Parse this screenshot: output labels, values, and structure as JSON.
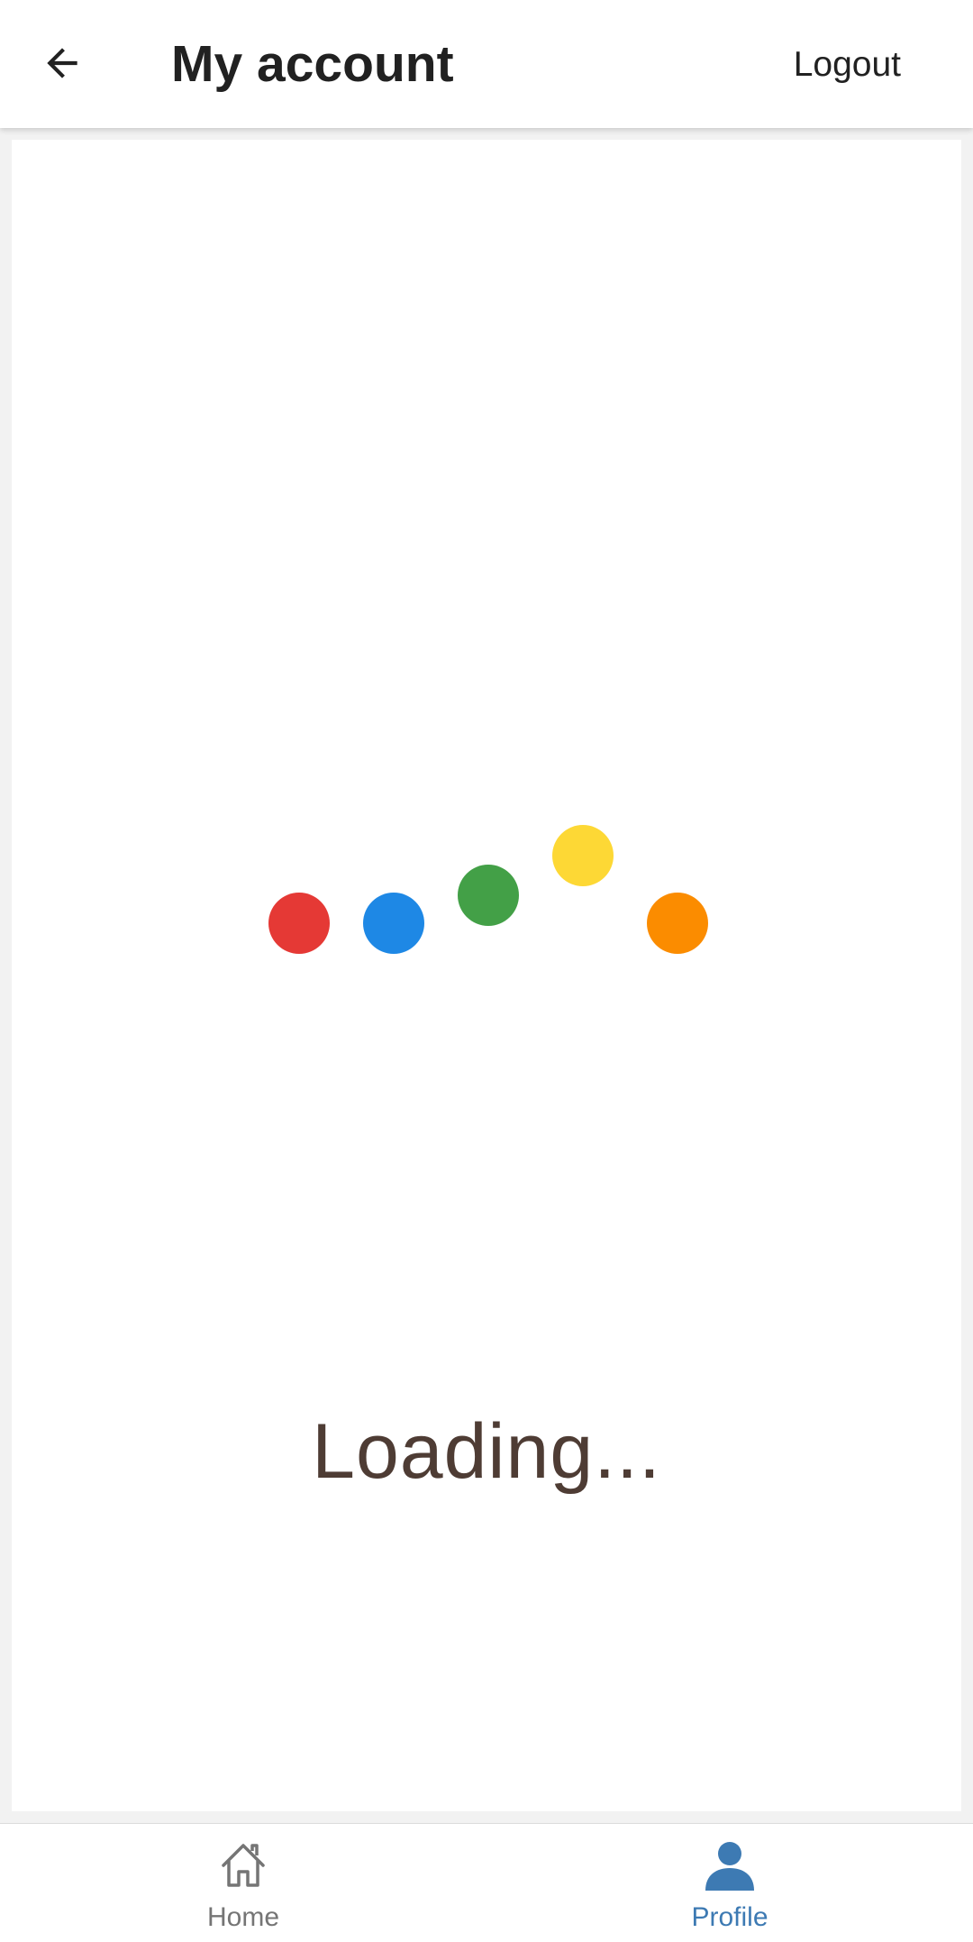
{
  "header": {
    "back_icon": "arrow-left-icon",
    "title": "My account",
    "logout_label": "Logout"
  },
  "loader": {
    "dots": [
      {
        "color": "#e53935"
      },
      {
        "color": "#1e88e5"
      },
      {
        "color": "#43a047"
      },
      {
        "color": "#fdd835"
      },
      {
        "color": "#fb8c00"
      }
    ],
    "text": "Loading..."
  },
  "bottom_nav": {
    "items": [
      {
        "label": "Home",
        "icon": "home-icon",
        "active": false
      },
      {
        "label": "Profile",
        "icon": "person-icon",
        "active": true
      }
    ],
    "active_color": "#3d7ab3",
    "inactive_color": "#757575"
  }
}
